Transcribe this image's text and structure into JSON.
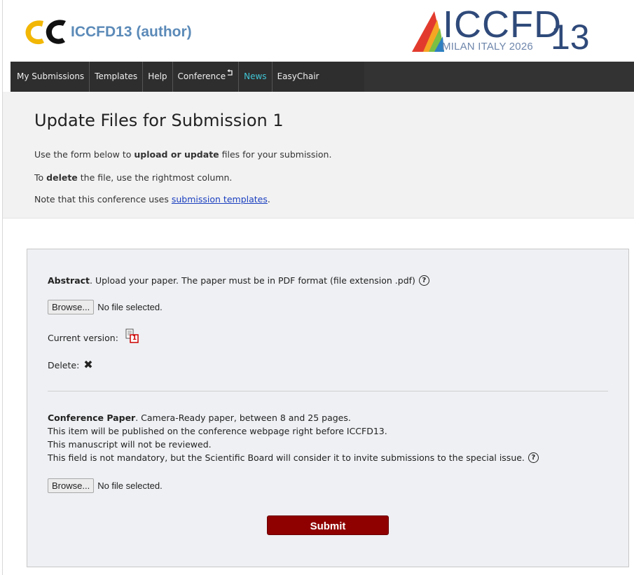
{
  "header": {
    "app_title": "ICCFD13 (author)",
    "conf_logo_main": "ICCFD",
    "conf_logo_number": "13",
    "conf_logo_sub": "MILAN ITALY 2026"
  },
  "nav": {
    "items": [
      "My Submissions",
      "Templates",
      "Help",
      "Conference",
      "News",
      "EasyChair"
    ]
  },
  "intro": {
    "title": "Update Files for Submission 1",
    "line1_pre": "Use the form below to ",
    "line1_bold": "upload or update",
    "line1_post": " files for your submission.",
    "line2_pre": "To ",
    "line2_bold": "delete",
    "line2_post": " the file, use the rightmost column.",
    "line3_pre": "Note that this conference uses ",
    "line3_link": "submission templates",
    "line3_post": "."
  },
  "abstract": {
    "label": "Abstract",
    "description": ". Upload your paper. The paper must be in PDF format (file extension .pdf)",
    "browse_label": "Browse...",
    "file_status": "No file selected.",
    "current_version_label": "Current version:",
    "current_version_badge": "1",
    "delete_label": "Delete:"
  },
  "conference_paper": {
    "label": "Conference Paper",
    "line1": ". Camera-Ready paper, between 8 and 25 pages.",
    "line2": "This item will be published on the conference webpage right before ICCFD13.",
    "line3": "This manuscript will not be reviewed.",
    "line4": "This field is not mandatory, but the Scientific Board will consider it to invite submissions to the special issue.",
    "browse_label": "Browse...",
    "file_status": "No file selected."
  },
  "form": {
    "submit_label": "Submit"
  },
  "colors": {
    "brand_blue": "#5b8ab8",
    "nav_bg": "#2e2e2e",
    "news_accent": "#41c6d6",
    "submit_bg": "#8f0000",
    "link": "#1a3fbf"
  }
}
